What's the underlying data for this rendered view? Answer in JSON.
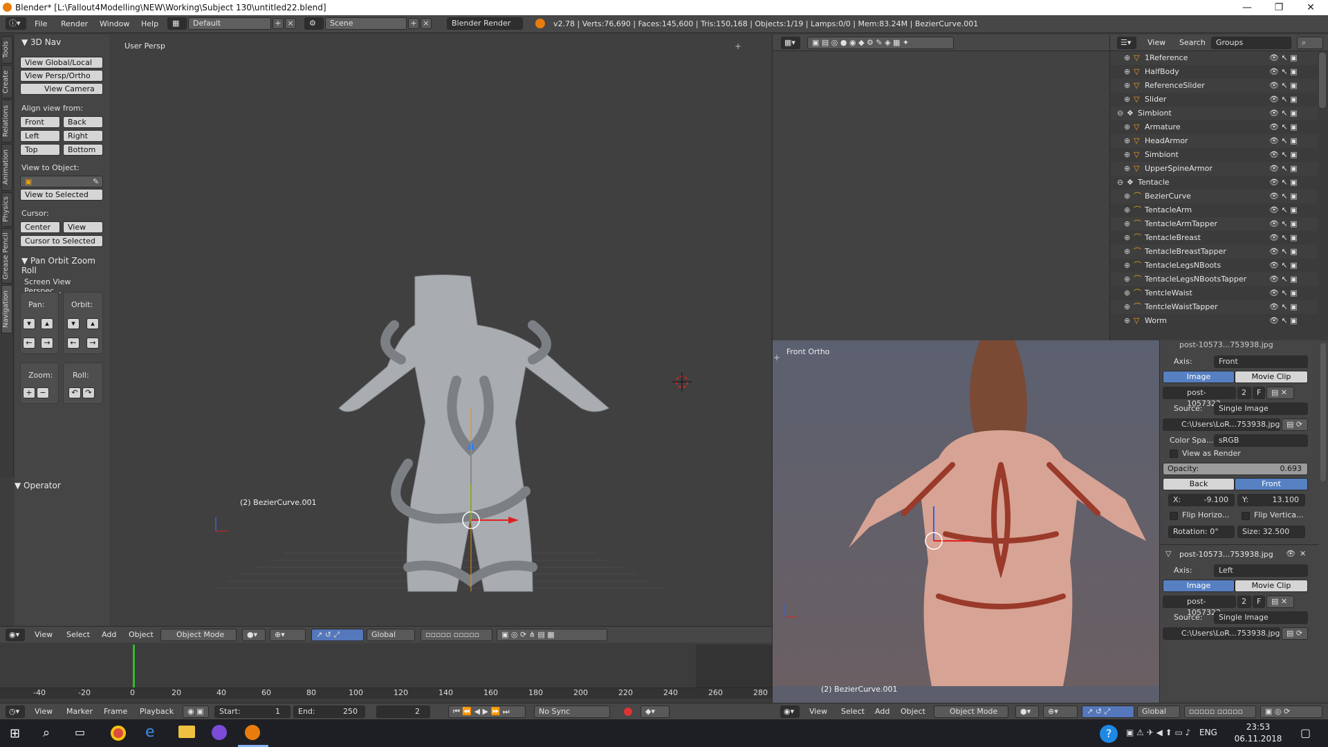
{
  "titlebar": {
    "title": "Blender* [L:\\Fallout4Modelling\\NEW\\Working\\Subject 130\\untitled22.blend]",
    "min_label": "—",
    "max_label": "❐",
    "close_label": "✕"
  },
  "infobar": {
    "menus": [
      "File",
      "Render",
      "Window",
      "Help"
    ],
    "screen_layout": "Default",
    "scene": "Scene",
    "render_engine": "Blender Render",
    "stats": "v2.78 | Verts:76,690 | Faces:145,600 | Tris:150,168 | Objects:1/19 | Lamps:0/0 | Mem:83.24M | BezierCurve.001"
  },
  "tool_tabs": [
    "Tools",
    "Create",
    "Relations",
    "Animation",
    "Physics",
    "Grease Pencil",
    "Navigation"
  ],
  "toolshelf": {
    "panel_3dnav": "3D Nav",
    "view_global_local": "View Global/Local",
    "view_persp_ortho": "View Persp/Ortho",
    "view_camera": "View Camera",
    "align_view_from": "Align view from:",
    "front": "Front",
    "back": "Back",
    "left": "Left",
    "right": "Right",
    "top": "Top",
    "bottom": "Bottom",
    "view_to_object": "View to Object:",
    "view_to_selected": "View to Selected",
    "cursor_label": "Cursor:",
    "center": "Center",
    "view": "View",
    "cursor_to_selected": "Cursor to Selected",
    "panel_pan_orbit": "Pan Orbit Zoom Roll",
    "screen_view": "Screen View Perspec...",
    "pan": "Pan:",
    "orbit": "Orbit:",
    "zoom": "Zoom:",
    "roll": "Roll:",
    "operator": "Operator"
  },
  "view3d": {
    "view_name": "User Persp",
    "object_label": "(2) BezierCurve.001",
    "header_menus": [
      "View",
      "Select",
      "Add",
      "Object"
    ],
    "mode": "Object Mode",
    "orientation": "Global"
  },
  "timeline": {
    "ticks": [
      "-40",
      "-20",
      "0",
      "20",
      "40",
      "60",
      "80",
      "100",
      "120",
      "140",
      "160",
      "180",
      "200",
      "220",
      "240",
      "260",
      "280"
    ],
    "menus": [
      "View",
      "Marker",
      "Frame",
      "Playback"
    ],
    "start_label": "Start:",
    "start_value": "1",
    "end_label": "End:",
    "end_value": "250",
    "current_frame": "2",
    "sync": "No Sync"
  },
  "outliner": {
    "menus": [
      "View",
      "Search"
    ],
    "display_mode": "Groups",
    "rows": [
      {
        "name": "1Reference",
        "indent": 2,
        "type": "mesh"
      },
      {
        "name": "HalfBody",
        "indent": 2,
        "type": "mesh"
      },
      {
        "name": "ReferenceSlider",
        "indent": 2,
        "type": "mesh"
      },
      {
        "name": "Slider",
        "indent": 2,
        "type": "mesh"
      },
      {
        "name": "Simbiont",
        "indent": 1,
        "type": "group"
      },
      {
        "name": "Armature",
        "indent": 2,
        "type": "mesh"
      },
      {
        "name": "HeadArmor",
        "indent": 2,
        "type": "mesh"
      },
      {
        "name": "Simbiont",
        "indent": 2,
        "type": "mesh"
      },
      {
        "name": "UpperSpineArmor",
        "indent": 2,
        "type": "mesh"
      },
      {
        "name": "Tentacle",
        "indent": 1,
        "type": "group"
      },
      {
        "name": "BezierCurve",
        "indent": 2,
        "type": "curve"
      },
      {
        "name": "TentacleArm",
        "indent": 2,
        "type": "curve"
      },
      {
        "name": "TentacleArmTapper",
        "indent": 2,
        "type": "curve"
      },
      {
        "name": "TentacleBreast",
        "indent": 2,
        "type": "curve"
      },
      {
        "name": "TentacleBreastTapper",
        "indent": 2,
        "type": "curve"
      },
      {
        "name": "TentacleLegsNBoots",
        "indent": 2,
        "type": "curve"
      },
      {
        "name": "TentacleLegsNBootsTapper",
        "indent": 2,
        "type": "curve"
      },
      {
        "name": "TentcleWaist",
        "indent": 2,
        "type": "curve"
      },
      {
        "name": "TentcleWaistTapper",
        "indent": 2,
        "type": "curve"
      },
      {
        "name": "Worm",
        "indent": 2,
        "type": "mesh"
      }
    ]
  },
  "imageview": {
    "view_name": "Front Ortho",
    "object_label": "(2) BezierCurve.001",
    "header_menus": [
      "View",
      "Select",
      "Add",
      "Object"
    ],
    "mode": "Object Mode",
    "orientation": "Global"
  },
  "bgpanel": {
    "top_filename": "post-10573...753938.jpg",
    "axis_label": "Axis:",
    "axis1": "Front",
    "image_tab": "Image",
    "movieclip_tab": "Movie Clip",
    "image_name": "post-1057322...",
    "users": "2",
    "fake": "F",
    "source_label": "Source:",
    "source": "Single Image",
    "filepath": "C:\\Users\\LoR...753938.jpg",
    "colorspace_label": "Color Spa...",
    "colorspace": "sRGB",
    "view_as_render": "View as Render",
    "opacity_label": "Opacity:",
    "opacity": "0.693",
    "back": "Back",
    "front": "Front",
    "x_label": "X:",
    "x_value": "-9.100",
    "y_label": "Y:",
    "y_value": "13.100",
    "flip_h": "Flip Horizo...",
    "flip_v": "Flip Vertica...",
    "rotation": "Rotation: 0°",
    "size": "Size: 32.500",
    "second_filename": "post-10573...753938.jpg",
    "axis2": "Left"
  },
  "taskbar": {
    "time": "23:53",
    "date": "06.11.2018",
    "lang": "ENG"
  }
}
